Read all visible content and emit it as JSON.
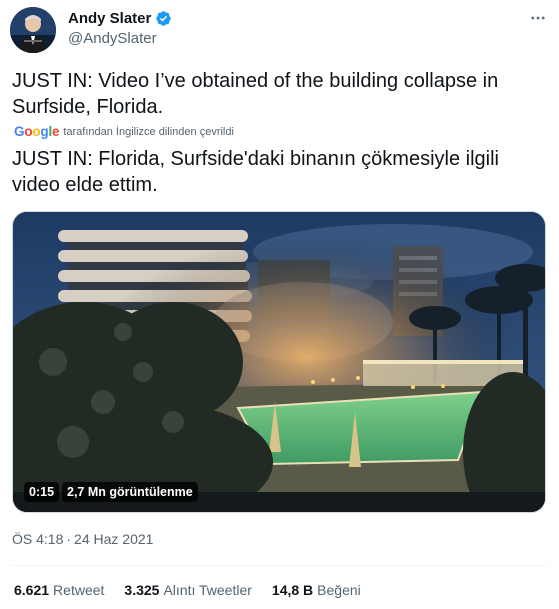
{
  "author": {
    "name": "Andy Slater",
    "handle": "@AndySlater",
    "verified": true
  },
  "icons": {
    "verified": "verified-badge-icon",
    "more": "more-dots-icon",
    "translator": "google-logo"
  },
  "tweet": {
    "original_text": "JUST IN: Video I’ve obtained of the building collapse in Surfside, Florida.",
    "translated_by": "tarafından İngilizce dilinden çevrildi",
    "translator_brand": "Google",
    "translated_text": "JUST IN: Florida, Surfside'daki binanın çökmesiyle ilgili video elde ettim."
  },
  "media": {
    "duration": "0:15",
    "views": "2,7 Mn görüntülenme"
  },
  "timestamp": {
    "time": "ÖS 4:18",
    "separator": "·",
    "date": "24 Haz 2021"
  },
  "stats": [
    {
      "value": "6.621",
      "label": "Retweet"
    },
    {
      "value": "3.325",
      "label": "Alıntı Tweetler"
    },
    {
      "value": "14,8 B",
      "label": "Beğeni"
    }
  ],
  "colors": {
    "text_primary": "#0f1419",
    "text_secondary": "#536471",
    "verified_blue": "#1d9bf0",
    "border": "#eff3f4"
  }
}
